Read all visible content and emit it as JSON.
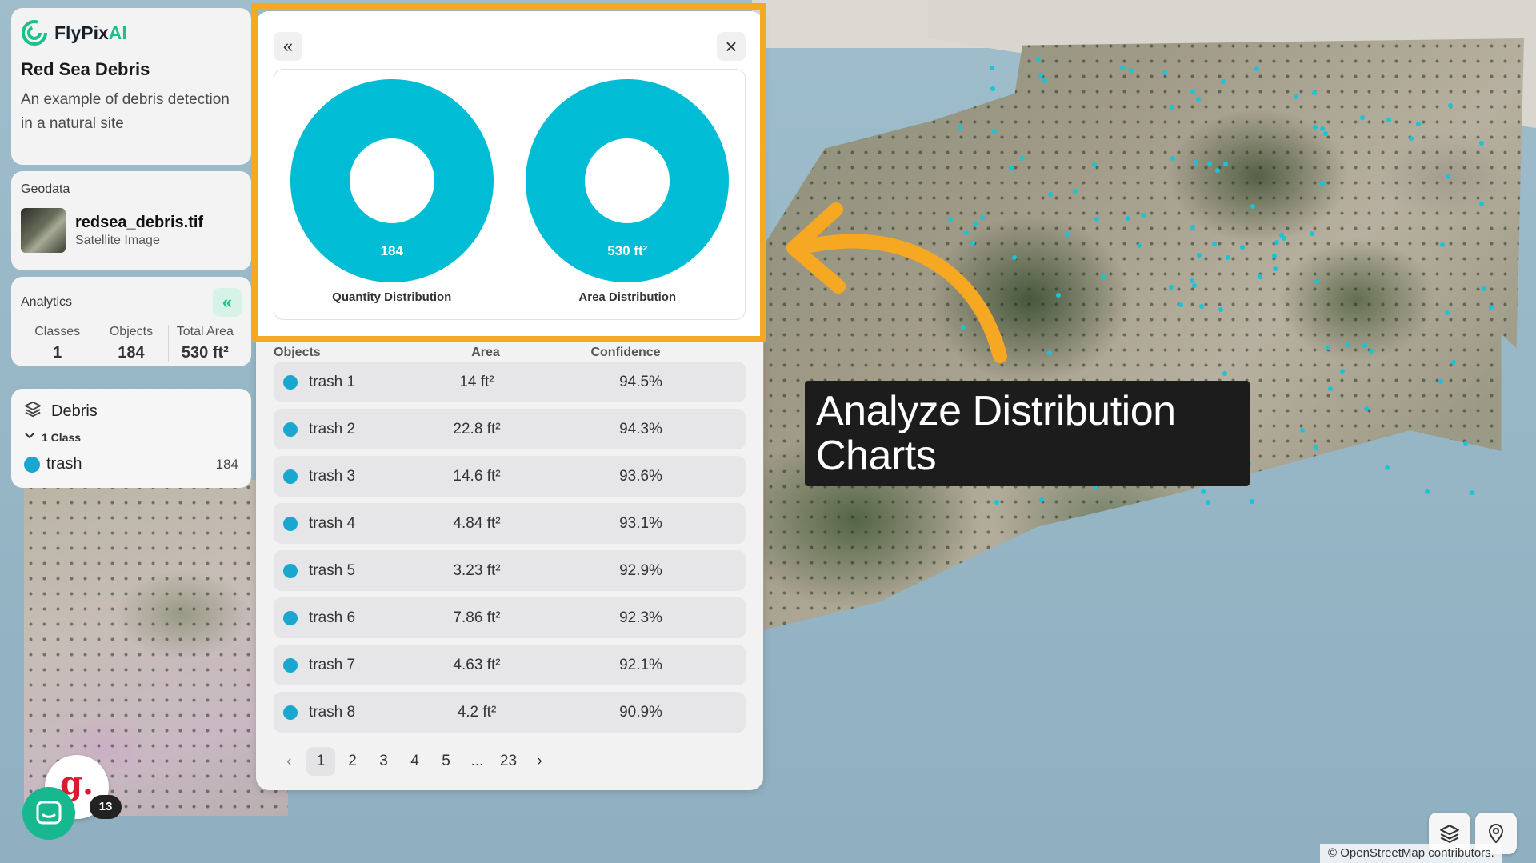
{
  "brand": {
    "name_main": "FlyPix",
    "name_accent": "AI"
  },
  "project": {
    "title": "Red Sea Debris",
    "description": "An example of debris detection in a natural site"
  },
  "geodata": {
    "section_label": "Geodata",
    "file_name": "redsea_debris.tif",
    "file_type": "Satellite Image"
  },
  "analytics": {
    "section_label": "Analytics",
    "stats": [
      {
        "label": "Classes",
        "value": "1"
      },
      {
        "label": "Objects",
        "value": "184"
      },
      {
        "label": "Total Area",
        "value": "530 ft²"
      }
    ]
  },
  "layer": {
    "name": "Debris",
    "class_count": "1 Class",
    "classes": [
      {
        "name": "trash",
        "count": "184",
        "color": "#1aa7cf"
      }
    ]
  },
  "panel": {
    "charts": [
      {
        "title": "Quantity Distribution",
        "center_label": "184",
        "color": "#00bcd4"
      },
      {
        "title": "Area Distribution",
        "center_label": "530 ft²",
        "color": "#00bcd4"
      }
    ],
    "table_headers": [
      "Objects",
      "Area",
      "Confidence"
    ],
    "rows": [
      {
        "name": "trash 1",
        "area": "14 ft²",
        "confidence": "94.5%"
      },
      {
        "name": "trash 2",
        "area": "22.8 ft²",
        "confidence": "94.3%"
      },
      {
        "name": "trash 3",
        "area": "14.6 ft²",
        "confidence": "93.6%"
      },
      {
        "name": "trash 4",
        "area": "4.84 ft²",
        "confidence": "93.1%"
      },
      {
        "name": "trash 5",
        "area": "3.23 ft²",
        "confidence": "92.9%"
      },
      {
        "name": "trash 6",
        "area": "7.86 ft²",
        "confidence": "92.3%"
      },
      {
        "name": "trash 7",
        "area": "4.63 ft²",
        "confidence": "92.1%"
      },
      {
        "name": "trash 8",
        "area": "4.2 ft²",
        "confidence": "90.9%"
      }
    ],
    "pagination": {
      "pages": [
        "1",
        "2",
        "3",
        "4",
        "5",
        "...",
        "23"
      ],
      "current": "1"
    }
  },
  "callout": {
    "line1": "Analyze Distribution",
    "line2": "Charts"
  },
  "badge": {
    "letter": "g.",
    "count": "13"
  },
  "attribution": "© OpenStreetMap contributors.",
  "colors": {
    "accent": "#1dbf8b",
    "highlight": "#f7a823",
    "donut": "#00bcd4",
    "class_dot": "#1aa7cf"
  },
  "icons": [
    "flypix-logo-icon",
    "layers-icon",
    "chevron-down-icon",
    "double-chevron-left-icon",
    "close-icon",
    "chevron-left-icon",
    "chevron-right-icon",
    "map-layers-icon",
    "map-pin-icon",
    "chat-icon"
  ]
}
